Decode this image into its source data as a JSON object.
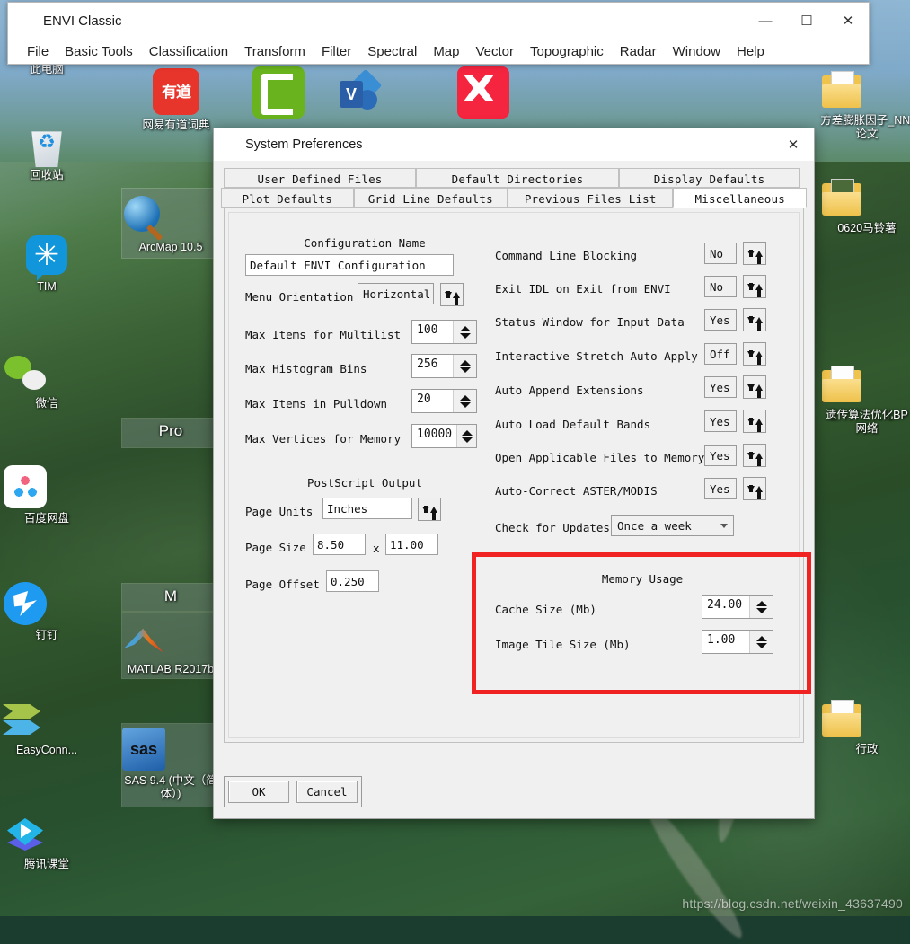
{
  "desktop": {
    "watermark": "https://blog.csdn.net/weixin_43637490",
    "icons_left": [
      {
        "label": "此电脑",
        "icon": "this-pc-icon"
      },
      {
        "label": "回收站",
        "icon": "recycle-bin-icon"
      },
      {
        "label": "TIM",
        "icon": "tim-icon"
      },
      {
        "label": "微信",
        "icon": "wechat-icon"
      },
      {
        "label": "百度网盘",
        "icon": "baidu-netdisk-icon"
      },
      {
        "label": "钉钉",
        "icon": "dingtalk-icon"
      },
      {
        "label": "EasyConn...",
        "icon": "easyconnect-icon"
      },
      {
        "label": "腾讯课堂",
        "icon": "tencent-ketang-icon"
      }
    ],
    "icons_col2": [
      {
        "label": "网易有道词典",
        "icon": "youdao-dict-icon"
      },
      {
        "label": "ArcMap 10.5",
        "icon": "arcmap-icon"
      },
      {
        "label": "Pro",
        "icon": "arcgis-pro-icon"
      },
      {
        "label": "M",
        "icon": "matlab-group-icon"
      },
      {
        "label": "MATLAB R2017b",
        "icon": "matlab-icon"
      },
      {
        "label": "SAS 9.4 (中文（简体）)",
        "icon": "sas-icon"
      }
    ],
    "icons_top": [
      {
        "label": "",
        "icon": "camtasia-icon"
      },
      {
        "label": "",
        "icon": "visio-icon"
      },
      {
        "label": "",
        "icon": "xmind-icon"
      }
    ],
    "icons_right": [
      {
        "label": "方差膨胀因子_NNI论文",
        "icon": "folder-icon"
      },
      {
        "label": "0620马铃薯",
        "icon": "folder-icon"
      },
      {
        "label": "遗传算法优化BP网络",
        "icon": "folder-icon"
      },
      {
        "label": "行政",
        "icon": "folder-icon"
      }
    ]
  },
  "envi_window": {
    "title": "ENVI Classic",
    "app_icon": "envi-logo-icon",
    "controls": {
      "minimize": "—",
      "maximize": "☐",
      "close": "✕"
    },
    "menu": [
      "File",
      "Basic Tools",
      "Classification",
      "Transform",
      "Filter",
      "Spectral",
      "Map",
      "Vector",
      "Topographic",
      "Radar",
      "Window",
      "Help"
    ]
  },
  "prefs_dialog": {
    "title": "System Preferences",
    "app_icon": "envi-logo-icon",
    "close_label": "✕",
    "tabs_row1": [
      "User Defined Files",
      "Default Directories",
      "Display Defaults"
    ],
    "tabs_row2": [
      "Plot Defaults",
      "Grid Line Defaults",
      "Previous Files List",
      "Miscellaneous"
    ],
    "active_tab": "Miscellaneous",
    "left_column": {
      "config_name_title": "Configuration Name",
      "config_name_value": "Default ENVI Configuration",
      "menu_orientation_label": "Menu Orientation",
      "menu_orientation_value": "Horizontal",
      "fields": [
        {
          "label": "Max Items for Multilist",
          "value": "100"
        },
        {
          "label": "Max Histogram Bins",
          "value": "256"
        },
        {
          "label": "Max Items in Pulldown",
          "value": "20"
        },
        {
          "label": "Max Vertices for Memory",
          "value": "10000"
        }
      ],
      "postscript_title": "PostScript Output",
      "page_units_label": "Page Units",
      "page_units_value": "Inches",
      "page_size_label": "Page Size",
      "page_size_w": "8.50",
      "page_size_x": "x",
      "page_size_h": "11.00",
      "page_offset_label": "Page Offset",
      "page_offset_value": "0.250"
    },
    "right_column": {
      "toggles": [
        {
          "label": "Command Line Blocking",
          "value": "No"
        },
        {
          "label": "Exit IDL on Exit from ENVI",
          "value": "No"
        },
        {
          "label": "Status Window for Input Data",
          "value": "Yes"
        },
        {
          "label": "Interactive Stretch Auto Apply",
          "value": "Off"
        },
        {
          "label": "Auto Append Extensions",
          "value": "Yes"
        },
        {
          "label": "Auto Load Default Bands",
          "value": "Yes"
        },
        {
          "label": "Open Applicable Files to Memory",
          "value": "Yes"
        },
        {
          "label": "Auto-Correct ASTER/MODIS",
          "value": "Yes"
        }
      ],
      "check_updates_label": "Check for Updates",
      "check_updates_value": "Once a week",
      "memory": {
        "title": "Memory Usage",
        "rows": [
          {
            "label": "Cache Size (Mb)",
            "value": "24.00"
          },
          {
            "label": "Image Tile Size (Mb)",
            "value": "1.00"
          }
        ],
        "highlight_color": "#f02222"
      }
    },
    "buttons": {
      "ok": "OK",
      "cancel": "Cancel"
    }
  }
}
